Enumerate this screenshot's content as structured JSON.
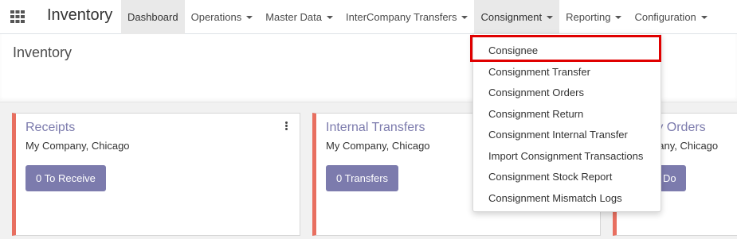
{
  "navbar": {
    "app_title": "Inventory",
    "menu": [
      {
        "label": "Dashboard",
        "has_caret": false,
        "active": true
      },
      {
        "label": "Operations",
        "has_caret": true,
        "active": false
      },
      {
        "label": "Master Data",
        "has_caret": true,
        "active": false
      },
      {
        "label": "InterCompany Transfers",
        "has_caret": true,
        "active": false
      },
      {
        "label": "Consignment",
        "has_caret": true,
        "active": true
      },
      {
        "label": "Reporting",
        "has_caret": true,
        "active": false
      },
      {
        "label": "Configuration",
        "has_caret": true,
        "active": false
      }
    ]
  },
  "control_panel": {
    "breadcrumb": "Inventory"
  },
  "cards": [
    {
      "title": "Receipts",
      "company": "My Company, Chicago",
      "button": "0 To Receive"
    },
    {
      "title": "Internal Transfers",
      "company": "My Company, Chicago",
      "button": "0 Transfers"
    },
    {
      "title": "ry Orders",
      "company": "pany, Chicago",
      "button": "Do"
    }
  ],
  "consignment_dropdown": {
    "items": [
      "Consignee",
      "Consignment Transfer",
      "Consignment Orders",
      "Consignment Return",
      "Consignment Internal Transfer",
      "Import Consignment Transactions",
      "Consignment Stock Report",
      "Consignment Mismatch Logs"
    ],
    "highlighted_item": "Consignee"
  },
  "colors": {
    "accent": "#7c7bad",
    "card_border": "#e86f60",
    "highlight_box": "#e00000"
  }
}
